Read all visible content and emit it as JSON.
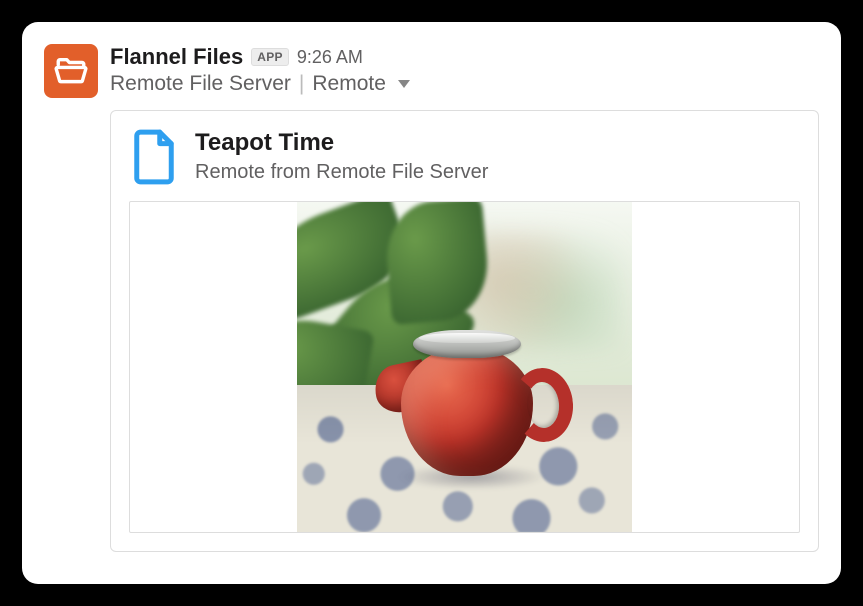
{
  "message": {
    "app_name": "Flannel Files",
    "app_badge": "APP",
    "timestamp": "9:26 AM",
    "context_app": "Remote File Server",
    "context_source": "Remote"
  },
  "attachment": {
    "title": "Teapot Time",
    "subtitle": "Remote from Remote File Server"
  }
}
